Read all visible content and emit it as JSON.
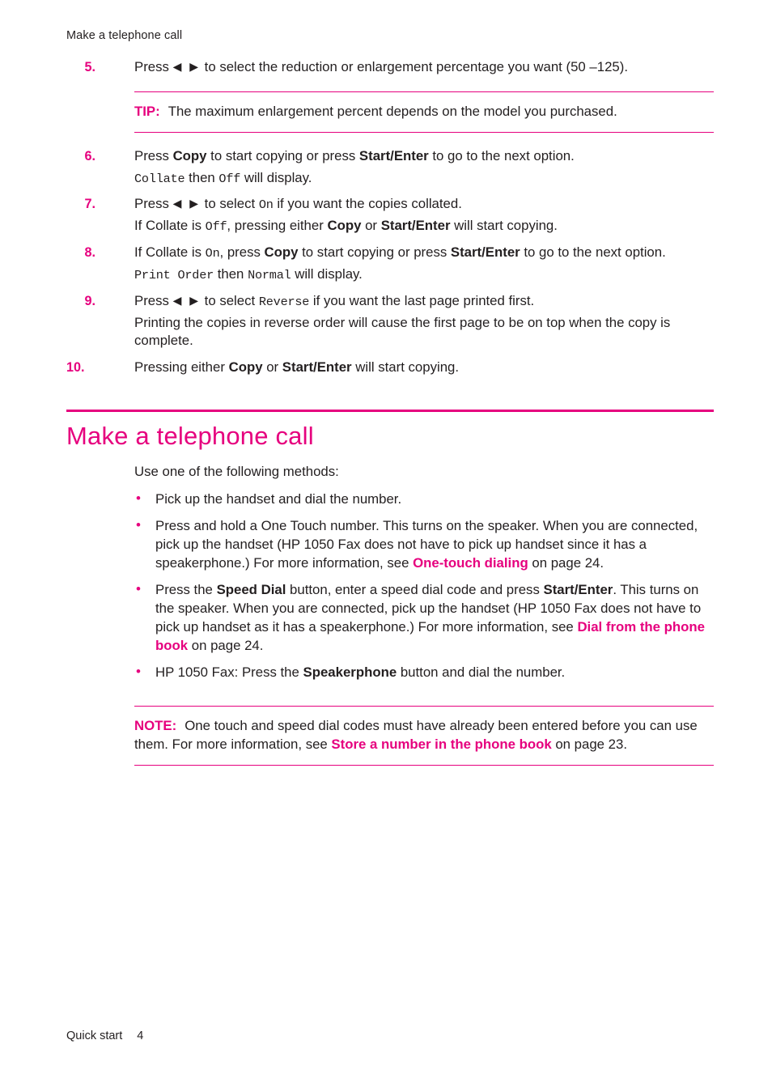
{
  "header": {
    "running_head": "Make a telephone call"
  },
  "steps": [
    {
      "num": "5.",
      "parts_html": "Press <span class=\"arrows\">◀ ▶</span> to select the reduction or enlargement percentage you want (50 –125)."
    },
    {
      "num": "6.",
      "parts_html": "Press <b>Copy</b> to start copying or press <b>Start/Enter</b> to go to the next option."
    },
    {
      "num": "7.",
      "parts_html": "Press <span class=\"arrows\">◀ ▶</span> to select <span class=\"mono\">On</span> if you want the copies collated."
    },
    {
      "num": "8.",
      "parts_html": "If Collate is <span class=\"mono\">On</span>, press <b>Copy</b> to start copying or press <b>Start/Enter</b> to go to the next option."
    },
    {
      "num": "9.",
      "parts_html": "Press <span class=\"arrows\">◀ ▶</span> to select <span class=\"mono\">Reverse</span> if you want the last page printed first."
    },
    {
      "num": "10.",
      "parts_html": "Pressing either <b>Copy</b> or <b>Start/Enter</b> will start copying."
    }
  ],
  "substeps": {
    "after6": "Collate then Off will display.",
    "after7": "If Collate is Off, pressing either Copy or Start/Enter will start copying.",
    "after8": "Print Order then Normal will display.",
    "after9": "Printing the copies in reverse order will cause the first page to be on top when the copy is complete."
  },
  "tip": {
    "label": "TIP:",
    "text": "The maximum enlargement percent depends on the model you purchased."
  },
  "note": {
    "label": "NOTE:",
    "text_before": "One touch and speed dial codes must have already been entered before you can use them. For more information, see ",
    "link": "Store a number in the phone book",
    "text_after": " on page 23."
  },
  "section": {
    "title": "Make a telephone call",
    "intro": "Use one of the following methods:",
    "bullets": [
      {
        "id": "bullet-handset",
        "html": "Pick up the handset and dial the number."
      },
      {
        "id": "bullet-one-touch",
        "html": "Press and hold a One Touch number. This turns on the speaker. When you are connected, pick up the handset (HP 1050 Fax does not have to pick up handset since it has a speakerphone.) For more information, see <a class=\"xref\" data-name=\"link-one-touch-dialing\" data-interactable=\"true\" href=\"#\">One-touch dialing</a> on page 24."
      },
      {
        "id": "bullet-speed-dial",
        "html": "Press the <b>Speed Dial</b> button, enter a speed dial code and press <b>Start/Enter</b>. This turns on the speaker. When you are connected, pick up the handset (HP 1050 Fax does not have to pick up handset as it has a speakerphone.) For more information, see <a class=\"xref\" data-name=\"link-dial-from-phone-book\" data-interactable=\"true\" href=\"#\">Dial from the phone book</a> on page 24."
      },
      {
        "id": "bullet-speakerphone",
        "html": "HP 1050 Fax: Press the <b>Speakerphone</b> button and dial the number."
      }
    ]
  },
  "footer": {
    "chapter": "Quick start",
    "page_number": "4"
  },
  "colors": {
    "accent": "#e6007e",
    "text": "#231f20"
  }
}
